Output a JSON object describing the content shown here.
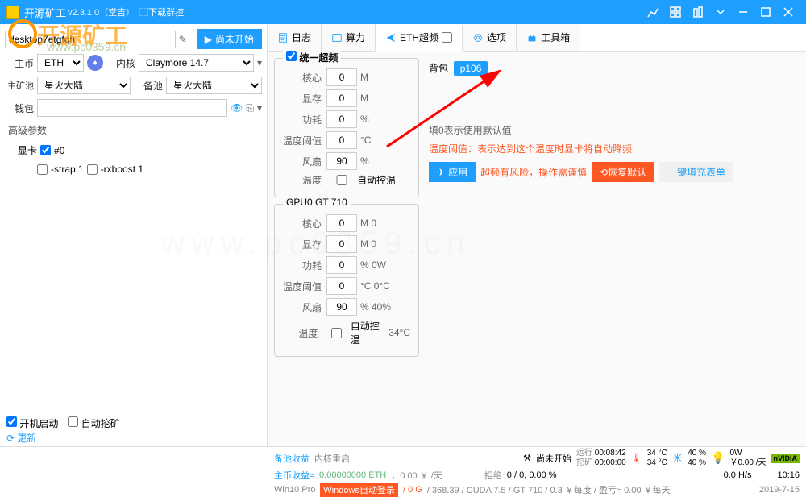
{
  "titlebar": {
    "title": "开源矿工",
    "version": "v2.3.1.0（堂吉）",
    "download": "⬚下载群控"
  },
  "sidebar": {
    "miner_name": "desktop7etgfqh",
    "start_btn": "尚未开始",
    "coin_label": "主币",
    "coin": "ETH",
    "kernel_label": "内核",
    "kernel": "Claymore 14.7",
    "pool_label": "主矿池",
    "pool": "星火大陆",
    "pool2_label": "备池",
    "pool2": "星火大陆",
    "wallet_label": "钱包",
    "wallet": "",
    "adv_label": "高级参数",
    "gpu_label": "显卡",
    "gpu0": "#0",
    "strap_label": "-strap 1",
    "rxboost_label": "-rxboost 1",
    "auto_start": "开机启动",
    "auto_mine": "自动挖矿",
    "refresh": "更新"
  },
  "tabs": {
    "log": "日志",
    "hashrate": "算力",
    "oc": "ETH超频",
    "options": "选项",
    "toolbox": "工具箱"
  },
  "oc": {
    "unified_title": "统一超频",
    "gpu0_title": "GPU0 GT 710",
    "core": "核心",
    "mem": "显存",
    "power": "功耗",
    "temp_limit": "温度阈值",
    "fan": "风扇",
    "temp": "温度",
    "auto_temp": "自动控温",
    "core_val": "0",
    "mem_val": "0",
    "power_val": "0",
    "templ_val": "0",
    "fan_val": "90",
    "unit_m": "M",
    "unit_pct": "%",
    "unit_c": "°C",
    "g0_core": "0",
    "g0_core_e": "M 0",
    "g0_mem": "0",
    "g0_mem_e": "M 0",
    "g0_pow": "0",
    "g0_pow_e": "% 0W",
    "g0_tl": "0",
    "g0_tl_e": "°C 0°C",
    "g0_fan": "90",
    "g0_fan_e": "% 40%",
    "g0_temp_e": "34°C"
  },
  "right": {
    "pack_label": "背包",
    "pack_tag": "p106",
    "hint1": "填0表示使用默认值",
    "hint2": "温度阈值：表示达到这个温度时显卡将自动降频",
    "apply": "应用",
    "warn": "超频有风险，操作需谨慎",
    "restore": "恢复默认",
    "fill": "一键填充表单"
  },
  "status": {
    "not_started": "尚未开始",
    "runtime_label": "运行",
    "runtime": "00:08:42",
    "mining_label": "挖矿",
    "mining": "00:00:00",
    "temp1": "34 °C",
    "temp2": "34 °C",
    "fan1": "40 %",
    "fan2": "40 %",
    "power": "0W",
    "power_cost": "￥0.00 /天",
    "time": "10:16",
    "pool_income": "备池收益",
    "kernel_restart": "内核重启",
    "main_income_label": "主币收益≈",
    "main_income": "0.00000000 ETH",
    "main_income_cny": "，0.00 ￥ /天",
    "reject_label": "拒绝",
    "reject": "0 / 0, 0.00 %",
    "hashrate": "0.0 H/s",
    "win": "Win10 Pro",
    "autologin": "Windows自动登录",
    "zero_g": "/ 0 G",
    "driver": "/ 368.39 / CUDA 7.5 / GT 710 / 0.3 ￥每度 / 盈亏≈ 0.00 ￥每天",
    "date": "2019-7-15"
  },
  "watermark": {
    "text": "开源矿工",
    "url": "www.pc0359.cn",
    "bg": "www.pc0359.cn"
  }
}
